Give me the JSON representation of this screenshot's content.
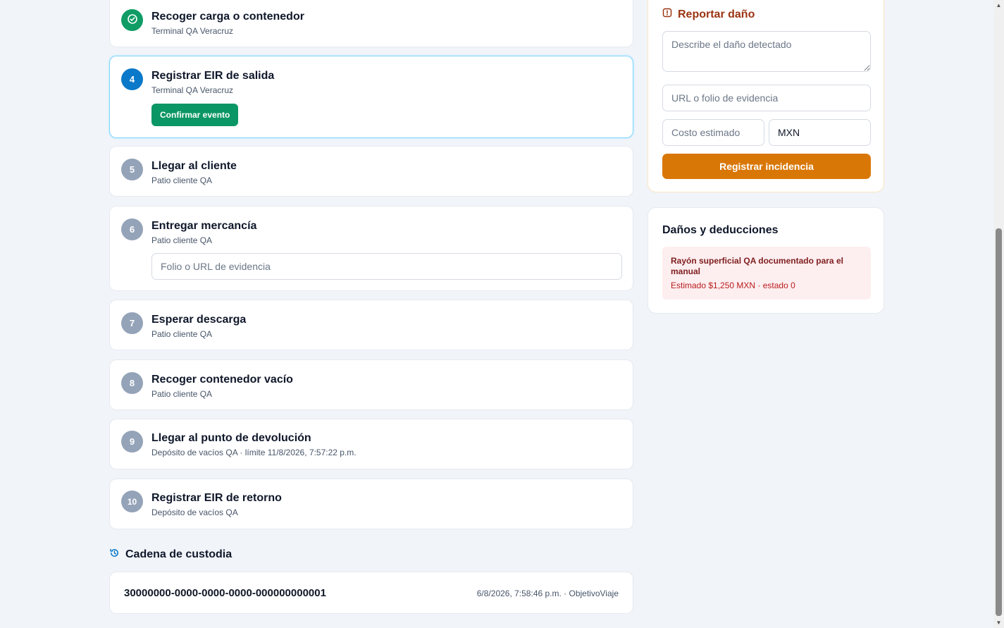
{
  "steps": [
    {
      "number": "",
      "title": "Recoger carga o contenedor",
      "subtitle": "Terminal QA Veracruz",
      "status": "done"
    },
    {
      "number": "4",
      "title": "Registrar EIR de salida",
      "subtitle": "Terminal QA Veracruz",
      "status": "current",
      "action_label": "Confirmar evento"
    },
    {
      "number": "5",
      "title": "Llegar al cliente",
      "subtitle": "Patio cliente QA",
      "status": "pending"
    },
    {
      "number": "6",
      "title": "Entregar mercancía",
      "subtitle": "Patio cliente QA",
      "status": "pending",
      "input_placeholder": "Folio o URL de evidencia"
    },
    {
      "number": "7",
      "title": "Esperar descarga",
      "subtitle": "Patio cliente QA",
      "status": "pending"
    },
    {
      "number": "8",
      "title": "Recoger contenedor vacío",
      "subtitle": "Patio cliente QA",
      "status": "pending"
    },
    {
      "number": "9",
      "title": "Llegar al punto de devolución",
      "subtitle": "Depósito de vacíos QA · límite 11/8/2026, 7:57:22 p.m.",
      "status": "pending"
    },
    {
      "number": "10",
      "title": "Registrar EIR de retorno",
      "subtitle": "Depósito de vacíos QA",
      "status": "pending"
    }
  ],
  "custody": {
    "title": "Cadena de custodia",
    "entries": [
      {
        "id": "30000000-0000-0000-0000-000000000001",
        "meta": "6/8/2026, 7:58:46 p.m. · ObjetivoViaje"
      }
    ]
  },
  "report": {
    "title": "Reportar daño",
    "description_placeholder": "Describe el daño detectado",
    "evidence_placeholder": "URL o folio de evidencia",
    "cost_placeholder": "Costo estimado",
    "currency_value": "MXN",
    "submit_label": "Registrar incidencia"
  },
  "damages": {
    "title": "Daños y deducciones",
    "items": [
      {
        "description": "Rayón superficial QA documentado para el manual",
        "meta": "Estimado $1,250 MXN · estado 0"
      }
    ]
  },
  "colors": {
    "done": "#0f9d65",
    "current": "#0b79c9",
    "pending": "#94a3b8",
    "primary_action": "#0b9666",
    "report_action": "#d97706"
  },
  "icons": {
    "done_step": "check-circle-icon",
    "report": "alert-square-icon",
    "custody": "history-icon"
  }
}
